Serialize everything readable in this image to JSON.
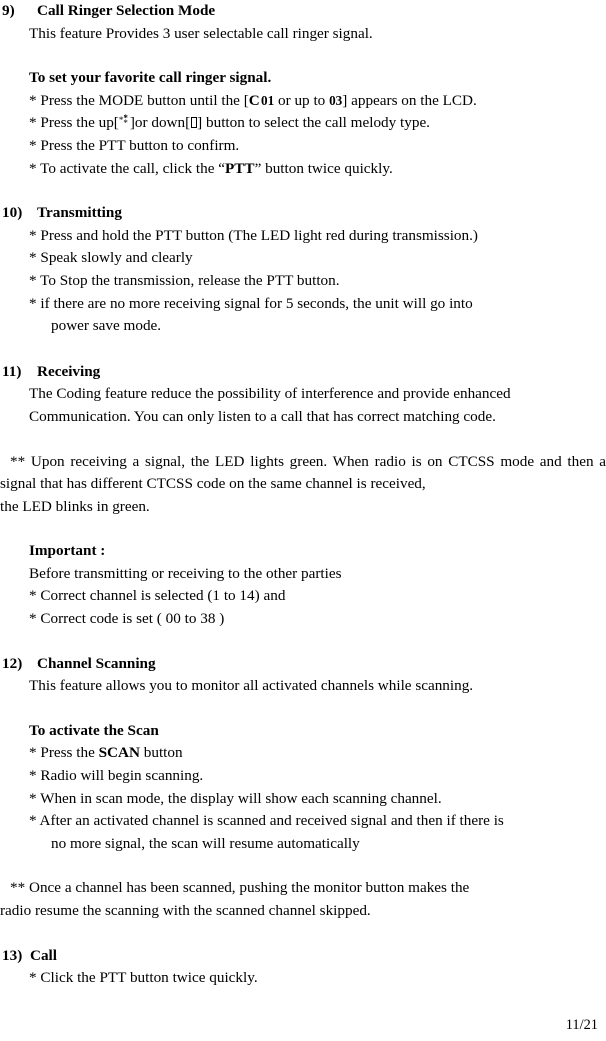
{
  "document": {
    "type": "two-way-radio-user-manual-page",
    "page_number": "11/21"
  },
  "sections": [
    {
      "id": "s9",
      "number": "9)",
      "title": "Call Ringer Selection Mode",
      "intro": "This feature Provides 3 user selectable call ringer signal.",
      "subheading": "To set your favorite call ringer signal.",
      "bullets": [
        {
          "prefix": "* Press the MODE button until the [",
          "code_letter": "C",
          "code_value_1": "01",
          "middle": " or up to ",
          "code_value_2": "03",
          "suffix": "] appears on the LCD."
        },
        {
          "prefix": "* Press the up[",
          "up_glyph": "asterism-up-icon",
          "middle": "]or down[",
          "down_glyph": "missing-glyph-box",
          "suffix": "] button to select the call melody type."
        },
        {
          "text": "* Press the PTT button to confirm."
        },
        {
          "prefix": "* To activate the call, click the “",
          "bold": "PTT",
          "suffix": "” button twice quickly."
        }
      ]
    },
    {
      "id": "s10",
      "number": "10)",
      "title": "Transmitting",
      "bullets": [
        {
          "text": "* Press and hold the PTT button (The LED light red during transmission.)"
        },
        {
          "text": "* Speak slowly and clearly"
        },
        {
          "text": "* To Stop the transmission, release the PTT button."
        },
        {
          "text": "* if there are no more receiving signal for 5 seconds, the unit will go into",
          "continuation": "power save mode."
        }
      ]
    },
    {
      "id": "s11",
      "number": "11)",
      "title": "Receiving",
      "prose": "The Coding feature reduce the possibility of interference and provide enhanced",
      "prose_last": "Communication. You can only listen to a call that has correct matching code.",
      "note": "** Upon receiving a signal, the LED lights green. When radio is on CTCSS mode and then a signal that has different CTCSS code on the same channel is received,",
      "note_last": "the LED blinks in green.",
      "important_heading": "Important :",
      "important_lines": [
        "Before transmitting or receiving to the other parties",
        "* Correct channel is selected (1 to 14) and",
        "* Correct code is set ( 00 to 38 )"
      ]
    },
    {
      "id": "s12",
      "number": "12)",
      "title": "Channel Scanning",
      "intro": "This feature allows you to monitor all activated channels while scanning.",
      "subheading": "To activate the Scan",
      "bullets": [
        {
          "prefix": "* Press the ",
          "bold": "SCAN",
          "suffix": " button"
        },
        {
          "text": "* Radio will begin scanning."
        },
        {
          "text": "* When in scan mode, the display will show each scanning channel."
        },
        {
          "text": "* After an activated channel is scanned and received signal and then if there is",
          "continuation": "no more signal, the scan will resume automatically"
        }
      ],
      "note": "** Once a channel has been scanned, pushing the monitor button makes the",
      "note_last": "radio resume the scanning with the scanned channel skipped."
    },
    {
      "id": "s13",
      "number": "13)",
      "title": "Call",
      "bullets": [
        {
          "text": "* Click the PTT button twice quickly."
        }
      ]
    }
  ]
}
